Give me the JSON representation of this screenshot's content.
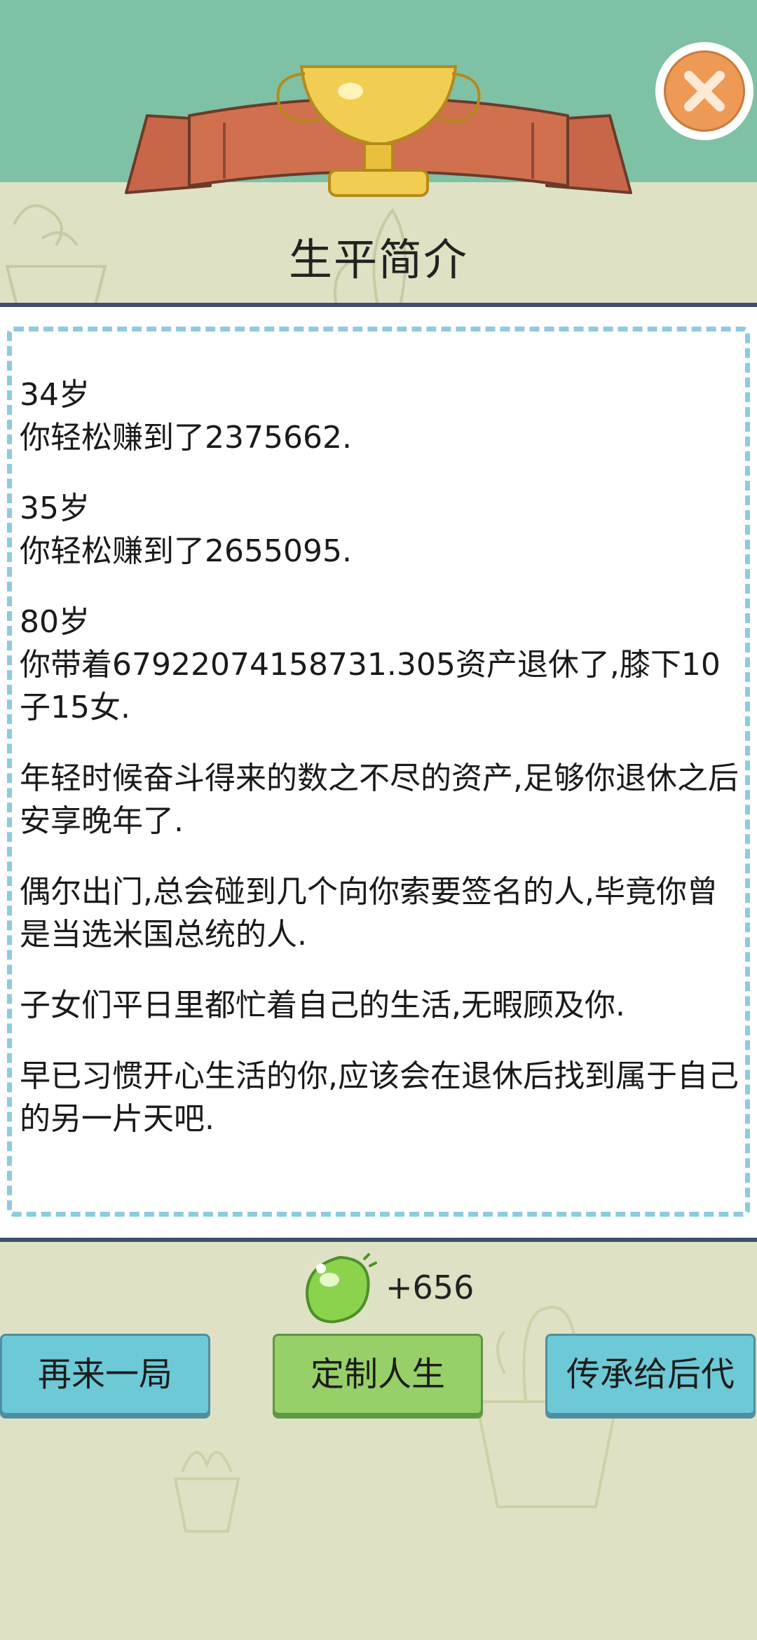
{
  "header": {
    "title": "生平简介"
  },
  "story": {
    "paragraphs": [
      "34岁\n你轻松赚到了2375662.",
      "35岁\n你轻松赚到了2655095.",
      "80岁\n你带着67922074158731.305资产退休了,膝下10子15女.",
      "年轻时候奋斗得来的数之不尽的资产,足够你退休之后安享晚年了.",
      "偶尔出门,总会碰到几个向你索要签名的人,毕竟你曾是当选米国总统的人.",
      "子女们平日里都忙着自己的生活,无暇顾及你.",
      "早已习惯开心生活的你,应该会在退休后找到属于自己的另一片天吧."
    ]
  },
  "reward": {
    "text": "+656",
    "icon": "green-gem-icon"
  },
  "buttons": {
    "restart": "再来一局",
    "customize": "定制人生",
    "inherit": "传承给后代"
  },
  "colors": {
    "top_band": "#7fc1a5",
    "background": "#dfe1c4",
    "close_button": "#ec9a55",
    "blue_button": "#6ec9d6",
    "green_button": "#97cf68",
    "dashed_border": "#8ecae0"
  }
}
